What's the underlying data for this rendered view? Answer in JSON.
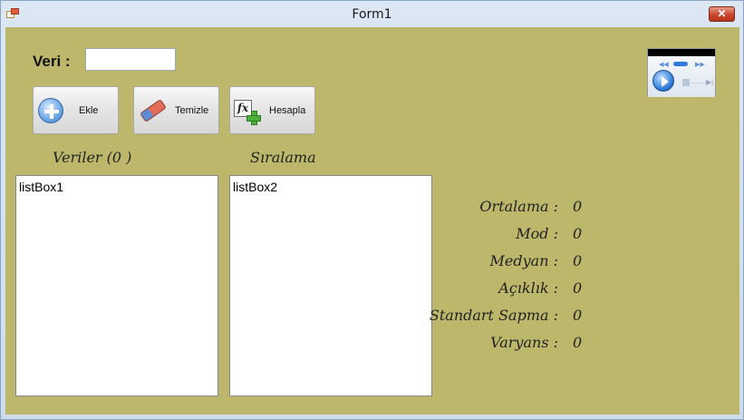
{
  "window": {
    "title": "Form1",
    "close_label": "✕"
  },
  "form": {
    "veri_label": "Veri :",
    "veri_value": "",
    "buttons": {
      "ekle": "Ekle",
      "temizle": "Temizle",
      "hesapla": "Hesapla",
      "fx_glyph": "fx"
    },
    "groups": {
      "veriler": "Veriler (0 )",
      "siralama": "Sıralama"
    },
    "listboxes": {
      "listbox1": "listBox1",
      "listbox2": "listBox2"
    },
    "stats": [
      {
        "label": "Ortalama :",
        "value": "0"
      },
      {
        "label": "Mod :",
        "value": "0"
      },
      {
        "label": "Medyan :",
        "value": "0"
      },
      {
        "label": "Açıklık :",
        "value": "0"
      },
      {
        "label": "Standart Sapma :",
        "value": "0"
      },
      {
        "label": "Varyans :",
        "value": "0"
      }
    ]
  },
  "colors": {
    "form_background": "#bdb76b",
    "close_button": "#c8452c"
  }
}
